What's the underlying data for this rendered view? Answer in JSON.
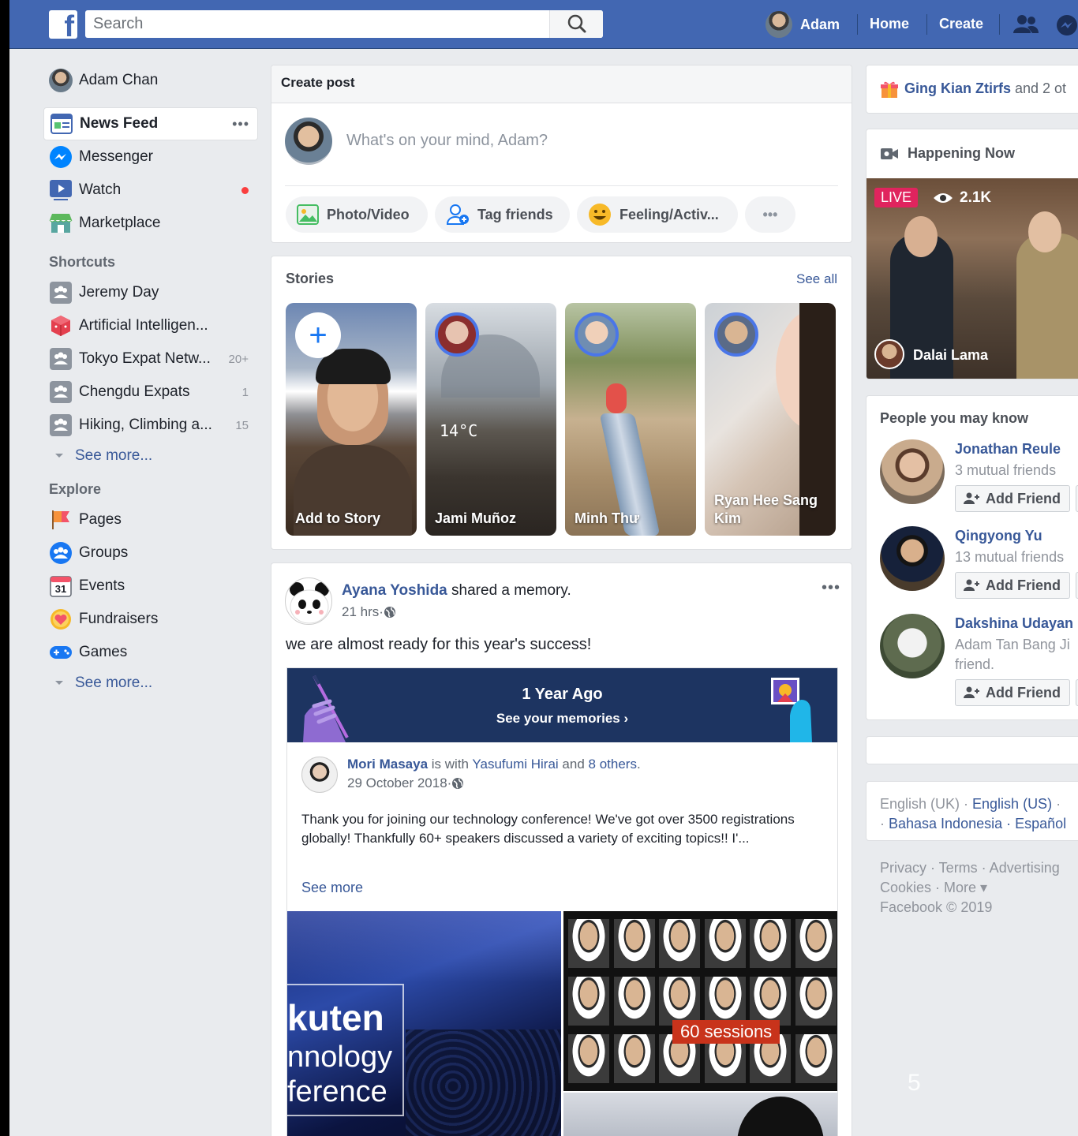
{
  "topbar": {
    "logo": "f",
    "search_placeholder": "Search",
    "user_name": "Adam",
    "home": "Home",
    "create": "Create"
  },
  "leftnav": {
    "user": "Adam Chan",
    "main": [
      {
        "label": "News Feed",
        "icon": "news-feed-icon"
      },
      {
        "label": "Messenger",
        "icon": "messenger-icon"
      },
      {
        "label": "Watch",
        "icon": "watch-icon"
      },
      {
        "label": "Marketplace",
        "icon": "marketplace-icon"
      }
    ],
    "more_dots": "•••",
    "shortcuts_title": "Shortcuts",
    "shortcuts": [
      {
        "label": "Jeremy Day",
        "badge": ""
      },
      {
        "label": "Artificial Intelligen...",
        "badge": ""
      },
      {
        "label": "Tokyo Expat Netw...",
        "badge": "20+"
      },
      {
        "label": "Chengdu Expats",
        "badge": "1"
      },
      {
        "label": "Hiking, Climbing a...",
        "badge": "15"
      }
    ],
    "see_more": "See more...",
    "explore_title": "Explore",
    "explore": [
      {
        "label": "Pages"
      },
      {
        "label": "Groups"
      },
      {
        "label": "Events",
        "icon_text": "31"
      },
      {
        "label": "Fundraisers"
      },
      {
        "label": "Games"
      }
    ]
  },
  "create_post": {
    "title": "Create post",
    "placeholder": "What's on your mind, Adam?",
    "buttons": [
      "Photo/Video",
      "Tag friends",
      "Feeling/Activ...",
      "•••"
    ]
  },
  "stories": {
    "title": "Stories",
    "see_all": "See all",
    "items": [
      {
        "name": "Add to Story"
      },
      {
        "name": "Jami Muñoz",
        "overlay": "14°C"
      },
      {
        "name": "Minh Thư"
      },
      {
        "name": "Ryan Hee Sang Kim"
      }
    ]
  },
  "post": {
    "author": "Ayana Yoshida",
    "action": " shared a memory.",
    "time": "21 hrs",
    "dot": " · ",
    "more": "•••",
    "text": "we are almost ready for this year's success!",
    "memory": {
      "title": "1 Year Ago",
      "subtitle": "See your memories ›",
      "shared_author": "Mori Masaya",
      "with": " is with ",
      "tagged": "Yasufumi Hirai",
      "and": " and ",
      "others": "8 others",
      "period": ".",
      "date": "29 October 2018",
      "body": "Thank you for joining our technology conference! We've got over 3500 registrations globally! Thankfully 60+ speakers discussed a variety of exciting topics!! I'...",
      "see_more": "See more",
      "img_text": [
        "kuten",
        "nnology",
        "ference"
      ],
      "sessions": "60 sessions"
    }
  },
  "right": {
    "birthday_name": "Ging Kian Ztirfs",
    "birthday_rest": " and 2 ot",
    "happening_title": "Happening Now",
    "live": "LIVE",
    "views": "2.1K",
    "live_name": "Dalai Lama",
    "people_title": "People you may know",
    "people": [
      {
        "name": "Jonathan Reule",
        "mutual": "3 mutual friends"
      },
      {
        "name": "Qingyong Yu",
        "mutual": "13 mutual friends"
      },
      {
        "name": "Dakshina Udayan",
        "mutual": "Adam Tan Bang Ji",
        "mutual2": "friend."
      }
    ],
    "add_friend": "Add Friend",
    "lang_line1_a": "English (UK) · ",
    "lang_line1_b": "English (US)",
    "lang_line1_c": " ·",
    "lang_line2_a": "· ",
    "lang_line2_b": "Bahasa Indonesia · Español",
    "footer1": "Privacy · Terms · Advertising",
    "footer2": "Cookies · More ▾",
    "footer3": "Facebook © 2019"
  },
  "slide_number": "5",
  "colors": {
    "brand": "#4267b2",
    "link": "#385898",
    "live": "#e0245e",
    "bg": "#e9ebee"
  }
}
